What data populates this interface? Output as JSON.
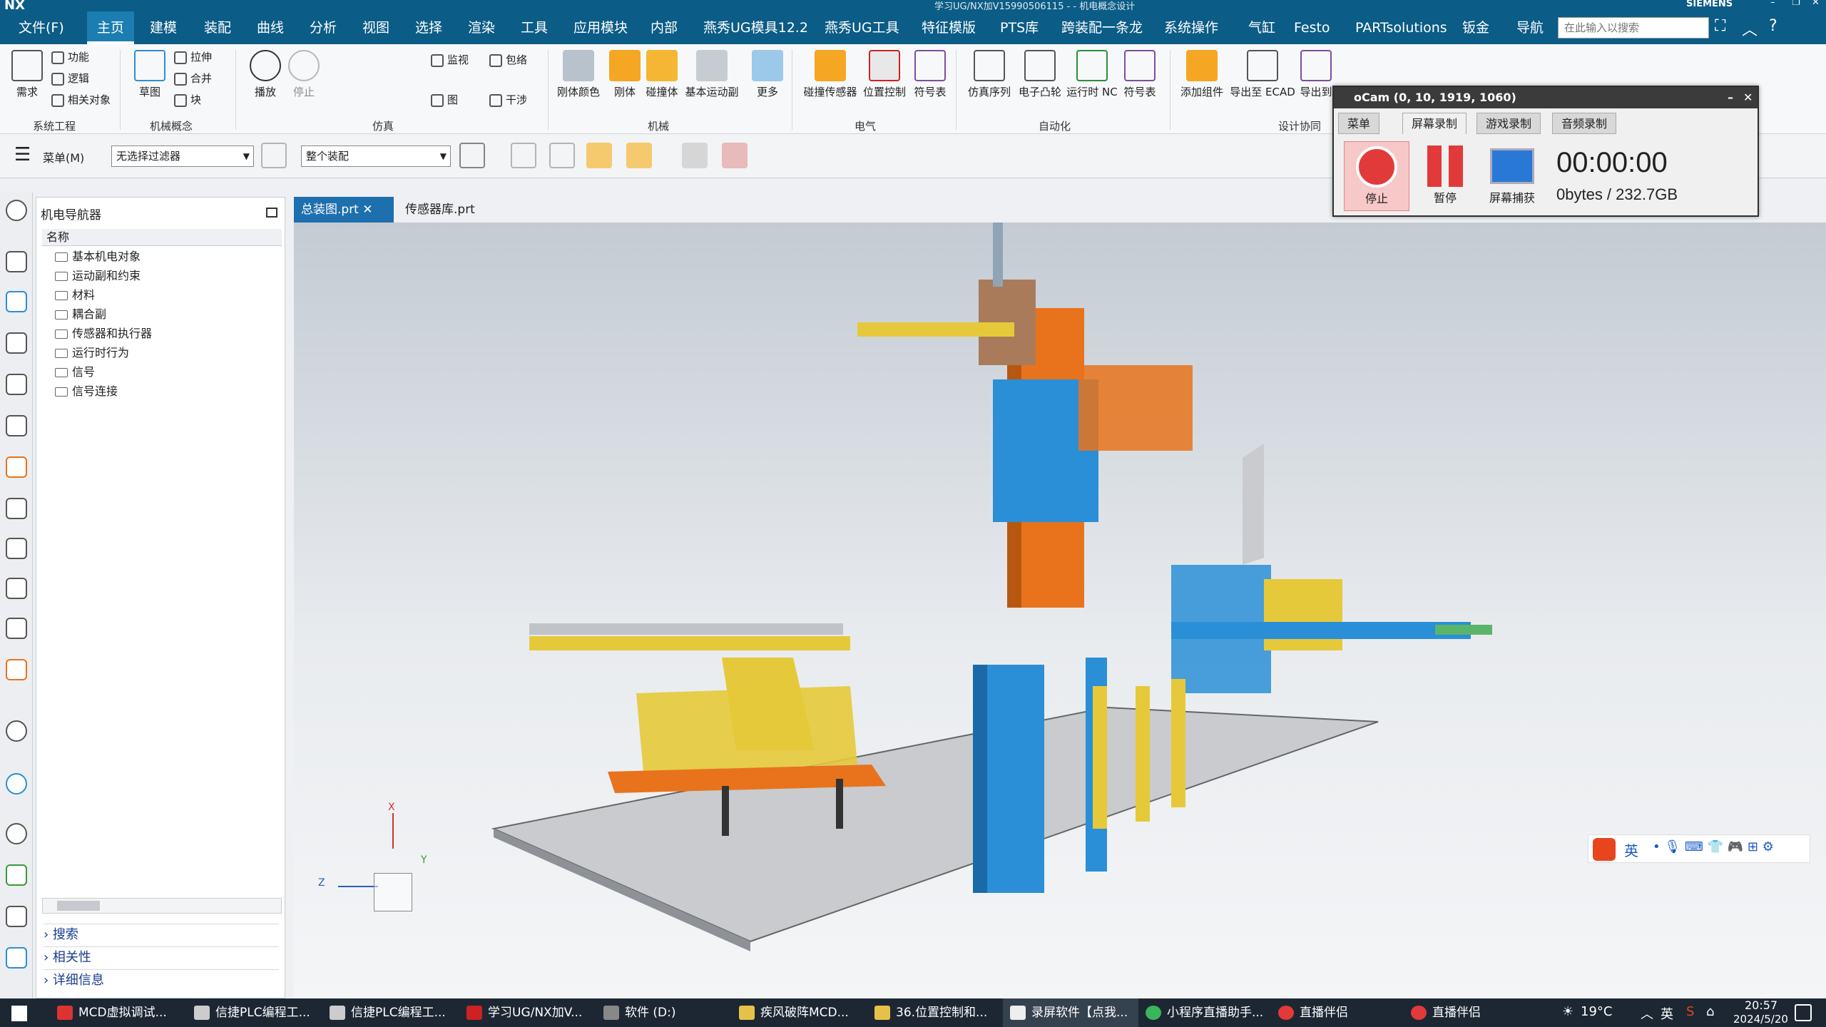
{
  "title": {
    "text": "学习UG/NX加V15990506115 - - 机电概念设计",
    "brand": "SIEMENS",
    "logo": "NX"
  },
  "menu": {
    "file": "文件(F)",
    "items": [
      "主页",
      "建模",
      "装配",
      "曲线",
      "分析",
      "视图",
      "选择",
      "渲染",
      "工具",
      "应用模块",
      "内部",
      "燕秀UG模具12.2",
      "燕秀UG工具",
      "特征模版",
      "PTS库",
      "跨装配一条龙",
      "系统操作",
      "气缸",
      "Festo",
      "PARTsolutions",
      "钣金",
      "导航"
    ],
    "active": "主页",
    "search_placeholder": "在此输入以搜索"
  },
  "ribbon": {
    "groups": [
      "系统工程",
      "机械概念",
      "仿真",
      "机械",
      "电气",
      "自动化",
      "设计协同"
    ],
    "sys_eng": {
      "big": "需求",
      "small": [
        "功能",
        "逻辑",
        "相关对象"
      ]
    },
    "mech_concept": {
      "big": "草图",
      "small": [
        "拉伸",
        "合并",
        "块"
      ]
    },
    "sim": {
      "play": "播放",
      "stop": "停止",
      "small": [
        "监视",
        "包络",
        "干涉"
      ],
      "more": "图"
    },
    "mech": {
      "buttons": [
        "刚体颜色",
        "刚体",
        "碰撞体",
        "基本运动副",
        "更多"
      ]
    },
    "elec": {
      "buttons": [
        "碰撞传感器",
        "位置控制",
        "符号表"
      ]
    },
    "auto": {
      "buttons": [
        "仿真序列",
        "电子凸轮",
        "运行时 NC",
        "符号表"
      ]
    },
    "collab": {
      "buttons": [
        "添加组件",
        "导出至 ECAD",
        "导出到"
      ]
    }
  },
  "toolbar2": {
    "menu": "菜单(M)",
    "filter": "无选择过滤器",
    "scope": "整个装配"
  },
  "navigator": {
    "title": "机电导航器",
    "column": "名称",
    "items": [
      "基本机电对象",
      "运动副和约束",
      "材料",
      "耦合副",
      "传感器和执行器",
      "运行时行为",
      "信号",
      "信号连接"
    ],
    "sections": [
      "搜索",
      "相关性",
      "详细信息"
    ]
  },
  "tabs": [
    {
      "label": "总装图.prt",
      "active": true
    },
    {
      "label": "传感器库.prt",
      "active": false
    }
  ],
  "axes": {
    "x": "X",
    "y": "Y",
    "z": "Z"
  },
  "ocam": {
    "title": "oCam (0, 10, 1919, 1060)",
    "tabs": [
      "菜单",
      "屏幕录制",
      "游戏录制",
      "音频录制"
    ],
    "active_tab": "屏幕录制",
    "stop": "停止",
    "pause": "暂停",
    "capture": "屏幕捕获",
    "timer": "00:00:00",
    "storage": "0bytes / 232.7GB"
  },
  "ime": {
    "label": "英"
  },
  "taskbar": {
    "items": [
      "MCD虚拟调试...",
      "信捷PLC编程工...",
      "信捷PLC编程工...",
      "学习UG/NX加V...",
      "软件 (D:)",
      "疾风破阵MCD...",
      "36.位置控制和...",
      "录屏软件【点我...",
      "小程序直播助手...",
      "直播伴侣",
      "直播伴侣"
    ],
    "temp": "19°C",
    "lang": "英",
    "time": "20:57",
    "date": "2024/5/20"
  },
  "colors": {
    "menubar": "#0b5c86",
    "accent": "#1e6fae",
    "orange": "#e8731c",
    "blue": "#2a8fd6",
    "yellow": "#e6c93a"
  }
}
